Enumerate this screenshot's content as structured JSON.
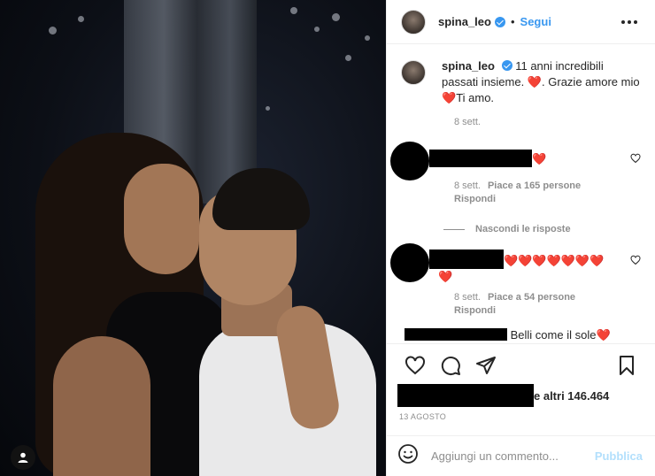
{
  "post": {
    "username": "spina_leo",
    "follow_label": "Segui",
    "dot": "•"
  },
  "caption": {
    "username": "spina_leo",
    "text_part1": "11 anni incredibili passati insieme.",
    "heart": "❤️",
    "text_part2": ". Grazie amore mio",
    "text_part3": "Ti amo.",
    "time": "8 sett."
  },
  "comments": [
    {
      "hearts": "❤️",
      "time": "8 sett.",
      "likes": "Piace a 165 persone",
      "reply_label": "Rispondi"
    },
    {
      "hearts": "❤️❤️❤️❤️❤️❤️❤️",
      "hearts_wrap": "❤️",
      "time": "8 sett.",
      "likes": "Piace a 54 persone",
      "reply_label": "Rispondi"
    }
  ],
  "hide_replies_label": "Nascondi le risposte",
  "partial_comment": {
    "text": "Belli come il sole",
    "heart": "❤️"
  },
  "likes": {
    "suffix": "e altri 146.464"
  },
  "date": "13 agosto",
  "comment_box": {
    "placeholder": "Aggiungi un commento...",
    "publish_label": "Pubblica"
  },
  "icons": {
    "like": "heart-icon",
    "comment": "comment-icon",
    "share": "paper-plane-icon",
    "save": "bookmark-icon",
    "emoji": "smiley-icon",
    "more": "more-dots-icon",
    "user_tag": "user-tag-icon"
  },
  "colors": {
    "accent": "#3897f0",
    "heart": "#ed4956",
    "muted": "#8e8e8e",
    "publish_disabled": "#b2dffc"
  }
}
